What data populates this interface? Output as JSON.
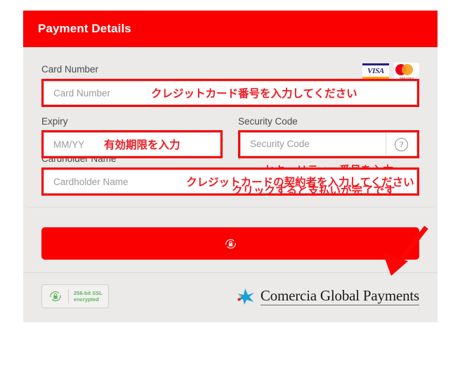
{
  "header": {
    "title": "Payment Details",
    "background_color": "#fb0000",
    "text_color": "#ffffff"
  },
  "brands": [
    {
      "name": "visa-logo",
      "label": "VISA"
    },
    {
      "name": "mastercard-logo",
      "label": "mastercard"
    }
  ],
  "fields": {
    "card_number": {
      "label": "Card Number",
      "placeholder": "Card Number",
      "value": "",
      "annotation": "クレジットカード番号を入力してください",
      "highlighted": true
    },
    "expiry": {
      "label": "Expiry",
      "placeholder": "MM/YY",
      "value": "",
      "annotation": "有効期限を入力",
      "highlighted": true
    },
    "security_code": {
      "label": "Security Code",
      "placeholder": "Security Code",
      "value": "",
      "help_icon": "?",
      "annotation": "セキュリティー番号を入力",
      "highlighted": true
    },
    "cardholder_name": {
      "label": "Cardholder Name",
      "placeholder": "Cardholder Name",
      "value": "",
      "annotation": "クレジットカードの契約者を入力してください",
      "highlighted": true
    }
  },
  "pay": {
    "annotation": "クリックすると支払いが完了です",
    "button_label": "",
    "button_icon": "lock-icon",
    "button_color": "#fb0000"
  },
  "footer": {
    "ssl_badge": {
      "icon": "lock-shield-icon",
      "line1": "256-bit SSL",
      "line2": "encrypted",
      "color": "#5fb65f"
    },
    "brand": {
      "logo": "comercia-star-icon",
      "name": "Comercia Global Payments"
    }
  },
  "annotation_style": {
    "color": "#ec1b23",
    "outline_color": "#fb0505"
  }
}
